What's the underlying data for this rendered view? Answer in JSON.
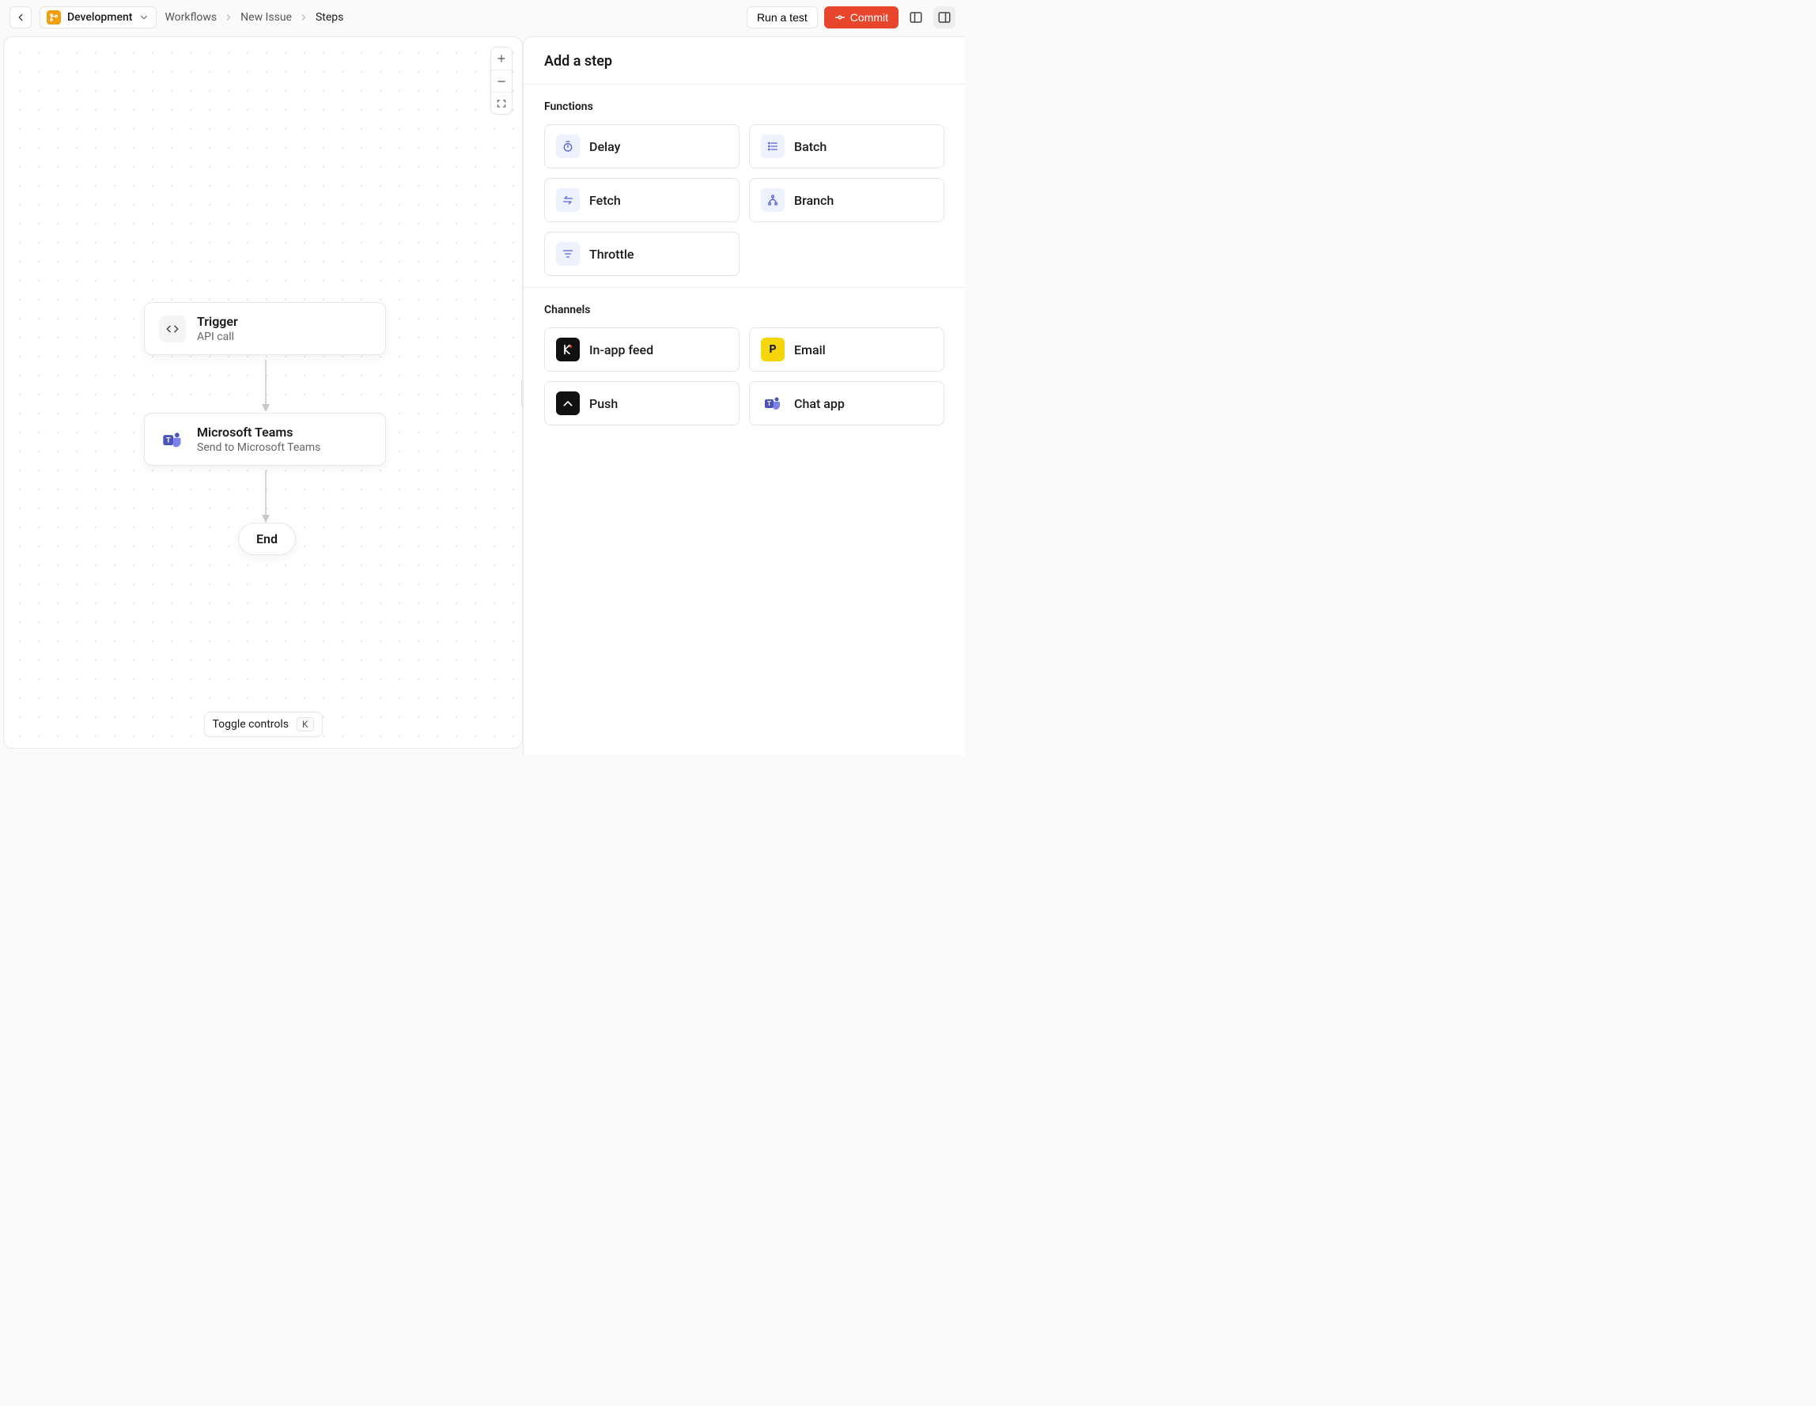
{
  "header": {
    "environment": "Development",
    "breadcrumbs": [
      "Workflows",
      "New Issue",
      "Steps"
    ],
    "run_test_label": "Run a test",
    "commit_label": "Commit"
  },
  "canvas": {
    "nodes": {
      "trigger": {
        "title": "Trigger",
        "subtitle": "API call"
      },
      "teams": {
        "title": "Microsoft Teams",
        "subtitle": "Send to Microsoft Teams"
      },
      "end": {
        "label": "End"
      }
    },
    "toggle_controls_label": "Toggle controls",
    "toggle_controls_key": "K"
  },
  "sidebar": {
    "title": "Add a step",
    "sections": [
      {
        "title": "Functions",
        "items": [
          {
            "label": "Delay",
            "icon": "timer-icon"
          },
          {
            "label": "Batch",
            "icon": "list-icon"
          },
          {
            "label": "Fetch",
            "icon": "swap-icon"
          },
          {
            "label": "Branch",
            "icon": "branch-icon"
          },
          {
            "label": "Throttle",
            "icon": "filter-icon"
          }
        ]
      },
      {
        "title": "Channels",
        "items": [
          {
            "label": "In-app feed",
            "icon": "knock-icon"
          },
          {
            "label": "Email",
            "icon": "postmark-icon"
          },
          {
            "label": "Push",
            "icon": "push-icon"
          },
          {
            "label": "Chat app",
            "icon": "teams-icon"
          }
        ]
      }
    ]
  }
}
